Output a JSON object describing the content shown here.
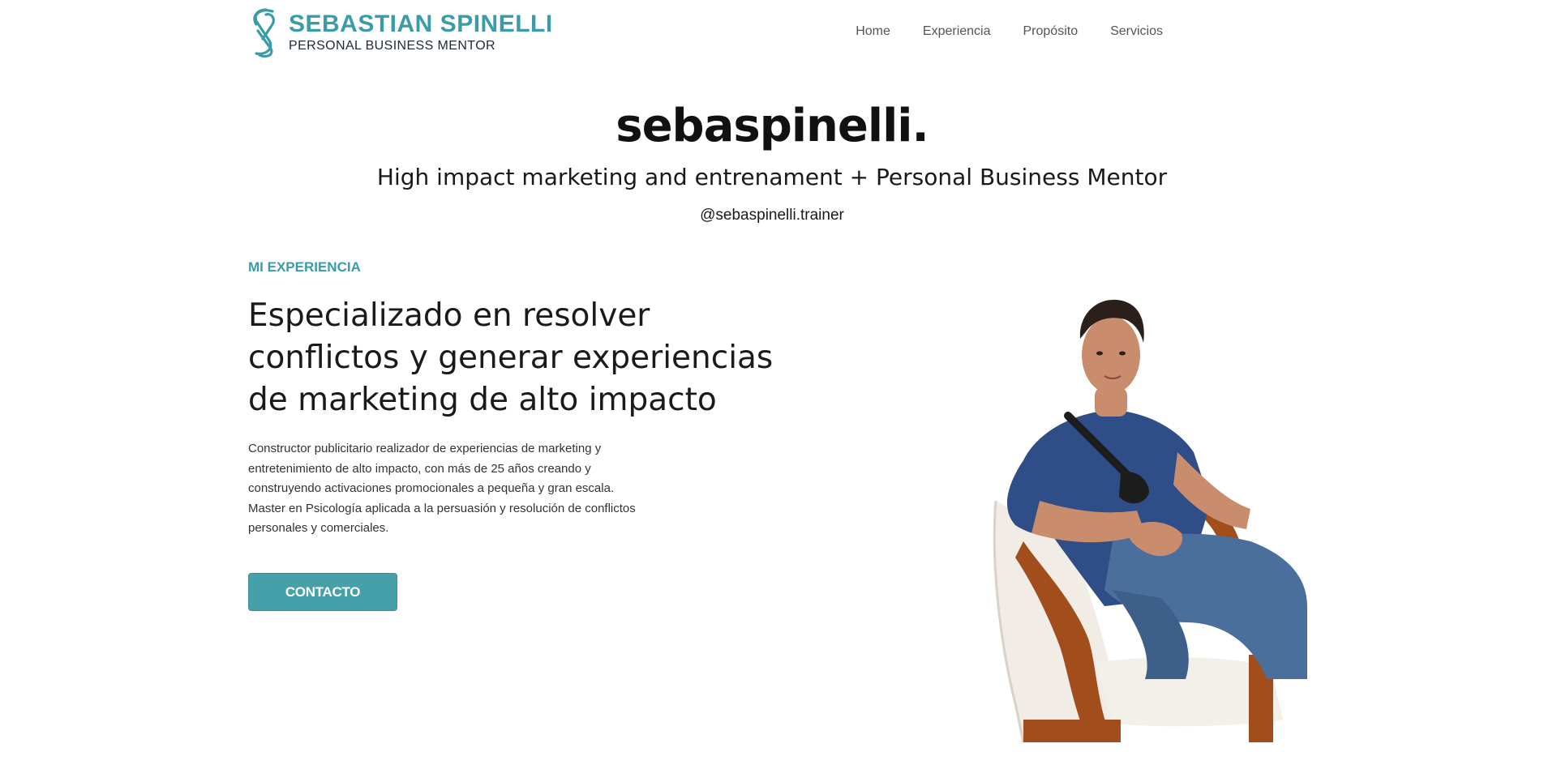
{
  "brand": {
    "name": "SEBASTIAN SPINELLI",
    "tagline": "PERSONAL BUSINESS MENTOR",
    "color": "#3a9ca8"
  },
  "nav": {
    "items": [
      {
        "label": "Home"
      },
      {
        "label": "Experiencia"
      },
      {
        "label": "Propósito"
      },
      {
        "label": "Servicios"
      }
    ]
  },
  "hero": {
    "title": "sebaspinelli.",
    "subtitle": "High impact marketing and entrenament + Personal Business Mentor",
    "handle": "@sebaspinelli.trainer"
  },
  "experience": {
    "label": "MI EXPERIENCIA",
    "heading": "Especializado en resolver conflictos y generar experiencias de marketing de alto impacto",
    "body": "Constructor publicitario realizador de experiencias de marketing y entretenimiento de alto impacto, con más de 25 años creando y construyendo activaciones promocionales a pequeña y gran escala. Master en Psicología aplicada a la persuasión y resolución de conflictos personales y comerciales.",
    "cta_label": "CONTACTO",
    "cta_color": "#45a0aa"
  },
  "photo": {
    "icon": "person-seated-in-armchair"
  }
}
